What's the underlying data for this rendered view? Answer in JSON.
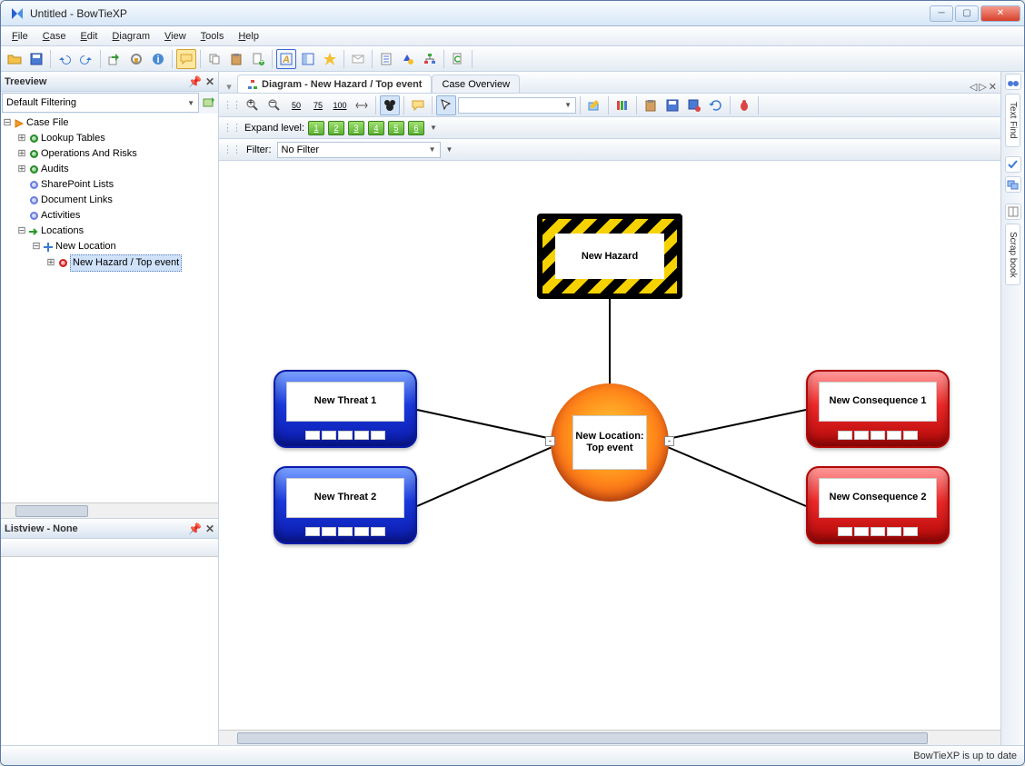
{
  "window": {
    "title": "Untitled - BowTieXP"
  },
  "menu": {
    "file": "File",
    "case": "Case",
    "edit": "Edit",
    "diagram": "Diagram",
    "view": "View",
    "tools": "Tools",
    "help": "Help"
  },
  "left": {
    "treeview_title": "Treeview",
    "filter_combo": "Default Filtering",
    "tree": {
      "root": "Case File",
      "lookup": "Lookup Tables",
      "operations": "Operations And Risks",
      "audits": "Audits",
      "sharepoint": "SharePoint Lists",
      "doclinks": "Document Links",
      "activities": "Activities",
      "locations": "Locations",
      "new_location": "New Location",
      "hazard_top": "New Hazard / Top event"
    },
    "listview_title": "Listview - None"
  },
  "tabs": {
    "diagram": "Diagram -  New Hazard / Top event",
    "overview": "Case Overview"
  },
  "diagbar": {
    "zoom50": "50",
    "zoom75": "75",
    "zoom100": "100",
    "expand_label": "Expand level:",
    "levels": [
      "1",
      "2",
      "3",
      "4",
      "5",
      "6"
    ],
    "filter_label": "Filter:",
    "filter_value": "No Filter"
  },
  "diagram": {
    "hazard": "New Hazard",
    "topevent": "New Location: Top event",
    "threat1": "New Threat 1",
    "threat2": "New Threat 2",
    "conseq1": "New Consequence 1",
    "conseq2": "New Consequence 2"
  },
  "sidetabs": {
    "textfind": "Text Find",
    "scrapbook": "Scrap book"
  },
  "status": "BowTieXP is up to date"
}
